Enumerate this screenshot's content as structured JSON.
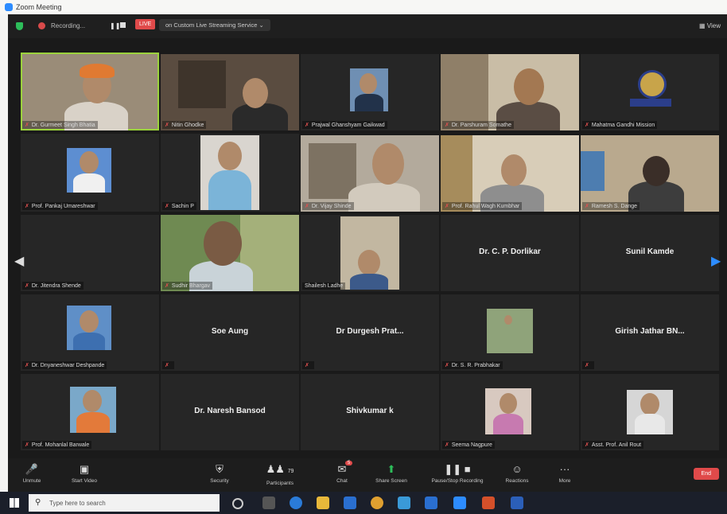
{
  "window": {
    "title": "Zoom Meeting"
  },
  "topbar": {
    "recording": "Recording...",
    "pause_icon": "pause-icon",
    "stop_icon": "stop-icon",
    "live": "LIVE",
    "streaming": "on Custom Live Streaming Service",
    "view": "View"
  },
  "participants": [
    {
      "name": "Dr. Gurmeet Singh Bhatia",
      "has_video": true
    },
    {
      "name": "Nitin Ghodke",
      "has_video": true
    },
    {
      "name": "Prajwal Ghanshyam Gaikwad",
      "has_video": true
    },
    {
      "name": "Dr. Parshuram Somathe",
      "has_video": true
    },
    {
      "name": "Mahatma Gandhi Mission",
      "has_video": true
    },
    {
      "name": "Prof. Pankaj Umareshwar",
      "has_video": true
    },
    {
      "name": "Sachin P",
      "has_video": true
    },
    {
      "name": "Dr. Vijay Shinde",
      "has_video": true
    },
    {
      "name": "Prof. Rahul Wagh Kumbhar",
      "has_video": true
    },
    {
      "name": "Ramesh S. Dange",
      "has_video": true
    },
    {
      "name": "Dr. Jitendra Shende",
      "has_video": false
    },
    {
      "name": "Sudhir Bhargav",
      "has_video": true
    },
    {
      "name": "Shailesh Ladhe",
      "has_video": true
    },
    {
      "name": "Dr. C. P. Dorlikar",
      "has_video": false
    },
    {
      "name": "Sunil Kamde",
      "has_video": false
    },
    {
      "name": "Dr. Dnyaneshwar Deshpande",
      "has_video": true
    },
    {
      "name": "Soe Aung",
      "has_video": false
    },
    {
      "name": "Dr Durgesh Prat...",
      "has_video": false
    },
    {
      "name": "Dr. S. R. Prabhakar",
      "has_video": true
    },
    {
      "name": "Girish Jathar BN...",
      "has_video": false
    },
    {
      "name": "Prof. Mohanlal Barwale",
      "has_video": true
    },
    {
      "name": "Dr. Naresh Bansod",
      "has_video": false
    },
    {
      "name": "Shivkumar k",
      "has_video": false
    },
    {
      "name": "Seema Nagpure",
      "has_video": true
    },
    {
      "name": "Asst. Prof. Anil Rout",
      "has_video": true
    }
  ],
  "nav": {
    "prev_icon": "chevron-left-icon",
    "next_icon": "chevron-right-icon"
  },
  "toolbar": {
    "unmute": "Unmute",
    "start_video": "Start Video",
    "security": "Security",
    "participants": "Participants",
    "participants_count": "79",
    "chat": "Chat",
    "chat_badge": "5",
    "share_screen": "Share Screen",
    "recording": "Pause/Stop Recording",
    "reactions": "Reactions",
    "more": "More",
    "end": "End"
  },
  "taskbar": {
    "search_placeholder": "Type here to search"
  },
  "colors": {
    "accent": "#2d8cff",
    "active_speaker": "#9bd23c",
    "danger": "#e04a4a",
    "share": "#2dbd5a"
  }
}
